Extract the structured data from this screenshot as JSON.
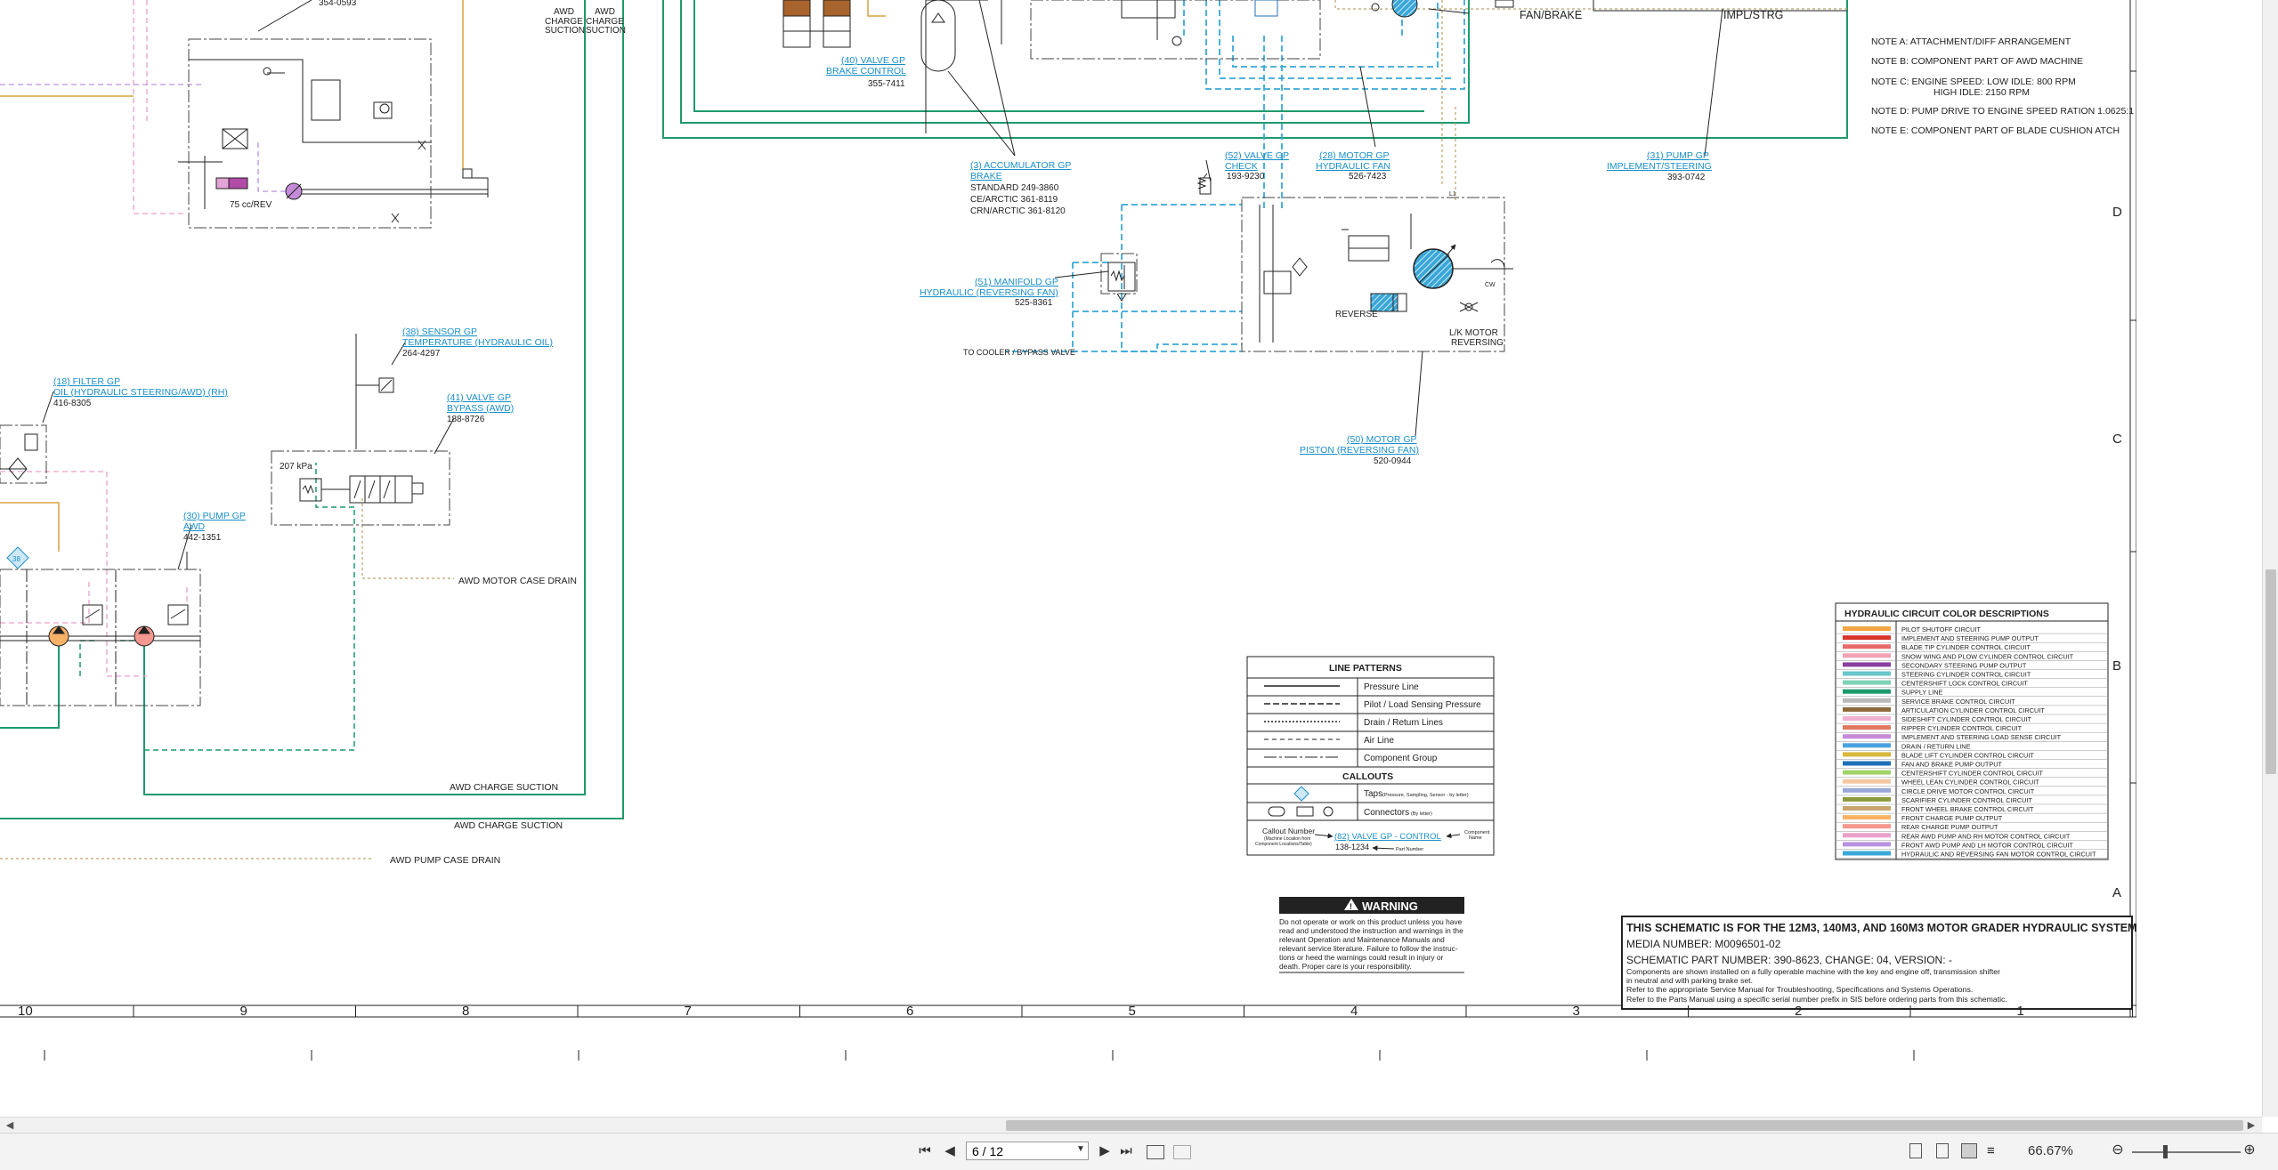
{
  "notes": {
    "a": "NOTE A: ATTACHMENT/DIFF ARRANGEMENT",
    "b": "NOTE B: COMPONENT PART OF AWD MACHINE",
    "c1": "NOTE C: ENGINE SPEED: LOW IDLE:   800 RPM",
    "c2": "HIGH IDLE:     2150 RPM",
    "d": "NOTE D: PUMP DRIVE TO ENGINE SPEED RATION 1.0625:1",
    "e": "NOTE E: COMPONENT PART OF BLADE CUSHION ATCH"
  },
  "top_labels": {
    "fan_brake": "FAN/BRAKE",
    "impl_strg": "IMPL/STRG",
    "awd_charge_suction_1": "AWD",
    "awd_charge_suction_2": "CHARGE",
    "awd_charge_suction_3": "SUCTION",
    "part_354": "354-0593"
  },
  "callouts": {
    "valve_brake": {
      "link1": "(40) VALVE GP",
      "link2": "BRAKE CONTROL",
      "part": "355-7411"
    },
    "accumulator": {
      "link1": "(3) ACCUMULATOR GP",
      "link2": "BRAKE",
      "l1": "STANDARD 249-3860",
      "l2": "CE/ARCTIC 361-8119",
      "l3": "CRN/ARCTIC 361-8120"
    },
    "valve_check": {
      "link1": "(52) VALVE GP",
      "link2": "CHECK",
      "part": "193-9230"
    },
    "motor_fan": {
      "link1": "(28) MOTOR GP",
      "link2": "HYDRAULIC FAN",
      "part": "526-7423"
    },
    "pump_impl": {
      "link1": "(31) PUMP GP",
      "link2": "IMPLEMENT/STEERING",
      "part": "393-0742"
    },
    "manifold": {
      "link1": "(51) MANIFOLD GP",
      "link2": "HYDRAULIC (REVERSING FAN)",
      "part": "525-8361"
    },
    "motor_piston": {
      "link1": "(50) MOTOR GP",
      "link2": "PISTON (REVERSING FAN)",
      "part": "520-0944"
    },
    "sensor": {
      "link1": "(38) SENSOR GP",
      "link2": "TEMPERATURE (HYDRAULIC OIL)",
      "part": "264-4297"
    },
    "filter": {
      "link1": "(18) FILTER GP",
      "link2": "OIL (HYDRAULIC STEERING/AWD) (RH)",
      "part": "416-8305"
    },
    "valve_bypass": {
      "link1": "(41) VALVE GP",
      "link2": "BYPASS (AWD)",
      "part": "188-8726"
    },
    "pump_awd": {
      "link1": "(30) PUMP GP",
      "link2": "AWD",
      "part": "442-1351"
    }
  },
  "diagram_text": {
    "cc_rev": "75 cc/REV",
    "kpa": "207 kPa",
    "to_cooler": "TO COOLER / BYPASS VALVE",
    "reverse": "REVERSE",
    "lk_motor1": "L/K MOTOR",
    "lk_motor2": "REVERSING",
    "awd_motor_case_drain": "AWD MOTOR CASE DRAIN",
    "awd_charge_suction_a": "AWD CHARGE SUCTION",
    "awd_charge_suction_b": "AWD CHARGE SUCTION",
    "awd_pump_case_drain": "AWD PUMP CASE DRAIN",
    "tap_badge": "38",
    "cw": "CW",
    "l1": "L1"
  },
  "line_patterns": {
    "title": "LINE PATTERNS",
    "items": [
      "Pressure Line",
      "Pilot / Load Sensing Pressure",
      "Drain / Return Lines",
      "Air Line",
      "Component Group"
    ],
    "callouts_title": "CALLOUTS",
    "taps": "Taps",
    "taps_note": "(Pressure, Sampling, Sensor - by letter)",
    "connectors": "Connectors",
    "connectors_note": "(By letter)",
    "callout_number": "Callout Number",
    "callout_number_note1": "(Machine Location from",
    "callout_number_note2": "Component Locations/Table)",
    "example_link": "(82) VALVE GP - CONTROL",
    "example_part": "138-1234",
    "component_name": "Component",
    "component_name2": "Name",
    "part_number": "Part Number"
  },
  "color_legend": {
    "title": "HYDRAULIC CIRCUIT COLOR DESCRIPTIONS",
    "items": [
      {
        "label": "PILOT SHUTOFF CIRCUIT",
        "color": "#f2a541"
      },
      {
        "label": "IMPLEMENT AND STEERING PUMP OUTPUT",
        "color": "#d9342b"
      },
      {
        "label": "BLADE TIP CYLINDER CONTROL CIRCUIT",
        "color": "#e86b6b"
      },
      {
        "label": "SNOW WING AND PLOW CYLINDER CONTROL CIRCUIT",
        "color": "#f3a3b6"
      },
      {
        "label": "SECONDARY STEERING PUMP OUTPUT",
        "color": "#8a3fa0"
      },
      {
        "label": "STEERING CYLINDER CONTROL CIRCUIT",
        "color": "#69c6c9"
      },
      {
        "label": "CENTERSHIFT LOCK CONTROL CIRCUIT",
        "color": "#7fd3b5"
      },
      {
        "label": "SUPPLY LINE",
        "color": "#1d9a6c"
      },
      {
        "label": "SERVICE BRAKE CONTROL CIRCUIT",
        "color": "#b9b9b9"
      },
      {
        "label": "ARTICULATION CYLINDER CONTROL CIRCUIT",
        "color": "#8c6a3a"
      },
      {
        "label": "SIDESHIFT CYLINDER CONTROL CIRCUIT",
        "color": "#f0b0d0"
      },
      {
        "label": "RIPPER CYLINDER CONTROL CIRCUIT",
        "color": "#e07a5f"
      },
      {
        "label": "IMPLEMENT AND STEERING LOAD SENSE CIRCUIT",
        "color": "#c58ad8"
      },
      {
        "label": "DRAIN / RETURN LINE",
        "color": "#4aa3df"
      },
      {
        "label": "BLADE LIFT CYLINDER CONTROL CIRCUIT",
        "color": "#d7b83c"
      },
      {
        "label": "FAN AND BRAKE PUMP OUTPUT",
        "color": "#1d6fb8"
      },
      {
        "label": "CENTERSHIFT CYLINDER CONTROL CIRCUIT",
        "color": "#a0d468"
      },
      {
        "label": "WHEEL LEAN CYLINDER CONTROL CIRCUIT",
        "color": "#f6c7a1"
      },
      {
        "label": "CIRCLE DRIVE MOTOR CONTROL CIRCUIT",
        "color": "#9aa8d8"
      },
      {
        "label": "SCARIFIER CYLINDER CONTROL CIRCUIT",
        "color": "#8d9b3e"
      },
      {
        "label": "FRONT WHEEL BRAKE CONTROL CIRCUIT",
        "color": "#c8a66e"
      },
      {
        "label": "FRONT CHARGE PUMP OUTPUT",
        "color": "#f7b267"
      },
      {
        "label": "REAR CHARGE PUMP OUTPUT",
        "color": "#f4978e"
      },
      {
        "label": "REAR AWD PUMP AND RH MOTOR CONTROL CIRCUIT",
        "color": "#e9a0c9"
      },
      {
        "label": "FRONT AWD PUMP AND LH MOTOR CONTROL CIRCUIT",
        "color": "#b892e0"
      },
      {
        "label": "HYDRAULIC AND REVERSING FAN MOTOR CONTROL CIRCUIT",
        "color": "#3aa7d8"
      }
    ]
  },
  "warning": {
    "title": "WARNING",
    "lines": [
      "Do not operate or work on this product unless you have",
      "read and understood the instruction and warnings in the",
      "relevant Operation and Maintenance Manuals and",
      "relevant service literature. Failure to follow the instruc-",
      "tions or heed the warnings could result in injury or",
      "death. Proper care is your responsibility."
    ]
  },
  "title_block": {
    "title": "THIS SCHEMATIC IS FOR THE 12M3, 140M3, AND 160M3 MOTOR GRADER HYDRAULIC SYSTEM",
    "media": "MEDIA NUMBER: M0096501-02",
    "schematic": "SCHEMATIC PART NUMBER: 390-8623, CHANGE: 04, VERSION: -",
    "l1": "Components are shown installed on a fully operable machine with the key and engine off, transmission shifter",
    "l2": "in neutral and with parking brake set.",
    "l3": "Refer to the appropriate Service Manual for Troubleshooting, Specifications and Systems Operations.",
    "l4": "Refer to the Parts Manual using a specific serial number prefix in SIS before ordering parts from this schematic."
  },
  "ruler_numbers": [
    "10",
    "9",
    "8",
    "7",
    "6",
    "5",
    "4",
    "3",
    "2",
    "1"
  ],
  "ruler_letters": [
    "D",
    "C",
    "B",
    "A"
  ],
  "toolbar": {
    "page": "6 / 12",
    "zoom": "66.67%"
  }
}
